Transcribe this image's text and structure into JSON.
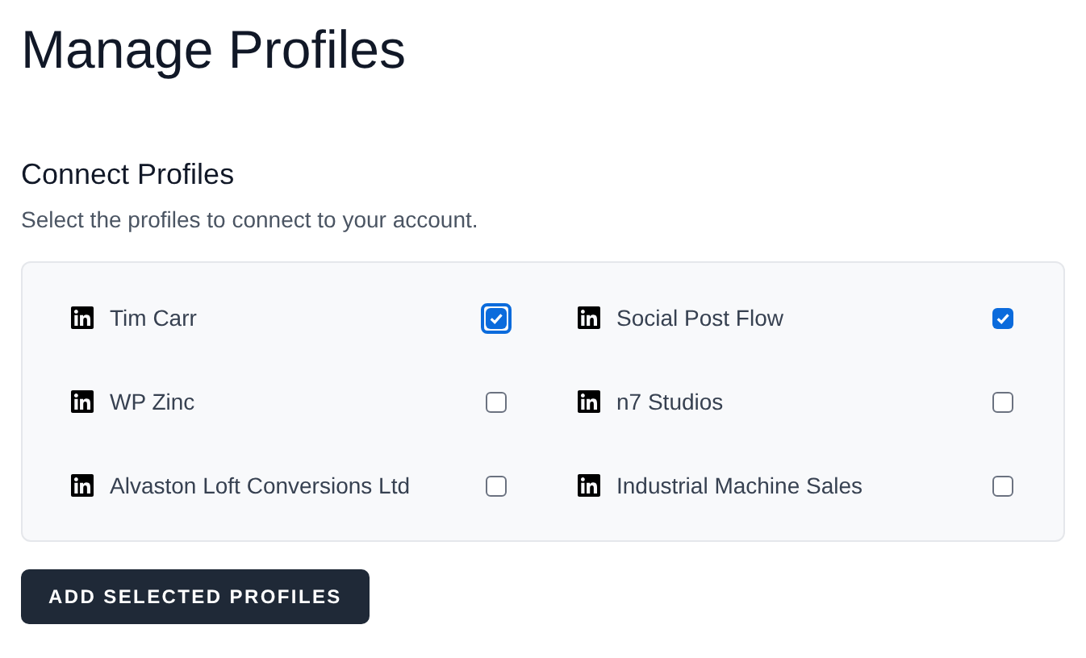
{
  "title": "Manage Profiles",
  "section": {
    "heading": "Connect Profiles",
    "description": "Select the profiles to connect to your account."
  },
  "profiles": [
    {
      "name": "Tim Carr",
      "checked": true,
      "focused": true
    },
    {
      "name": "Social Post Flow",
      "checked": true,
      "focused": false
    },
    {
      "name": "WP Zinc",
      "checked": false,
      "focused": false
    },
    {
      "name": "n7 Studios",
      "checked": false,
      "focused": false
    },
    {
      "name": "Alvaston Loft Conversions Ltd",
      "checked": false,
      "focused": false
    },
    {
      "name": "Industrial Machine Sales",
      "checked": false,
      "focused": false
    }
  ],
  "button": "ADD SELECTED PROFILES"
}
